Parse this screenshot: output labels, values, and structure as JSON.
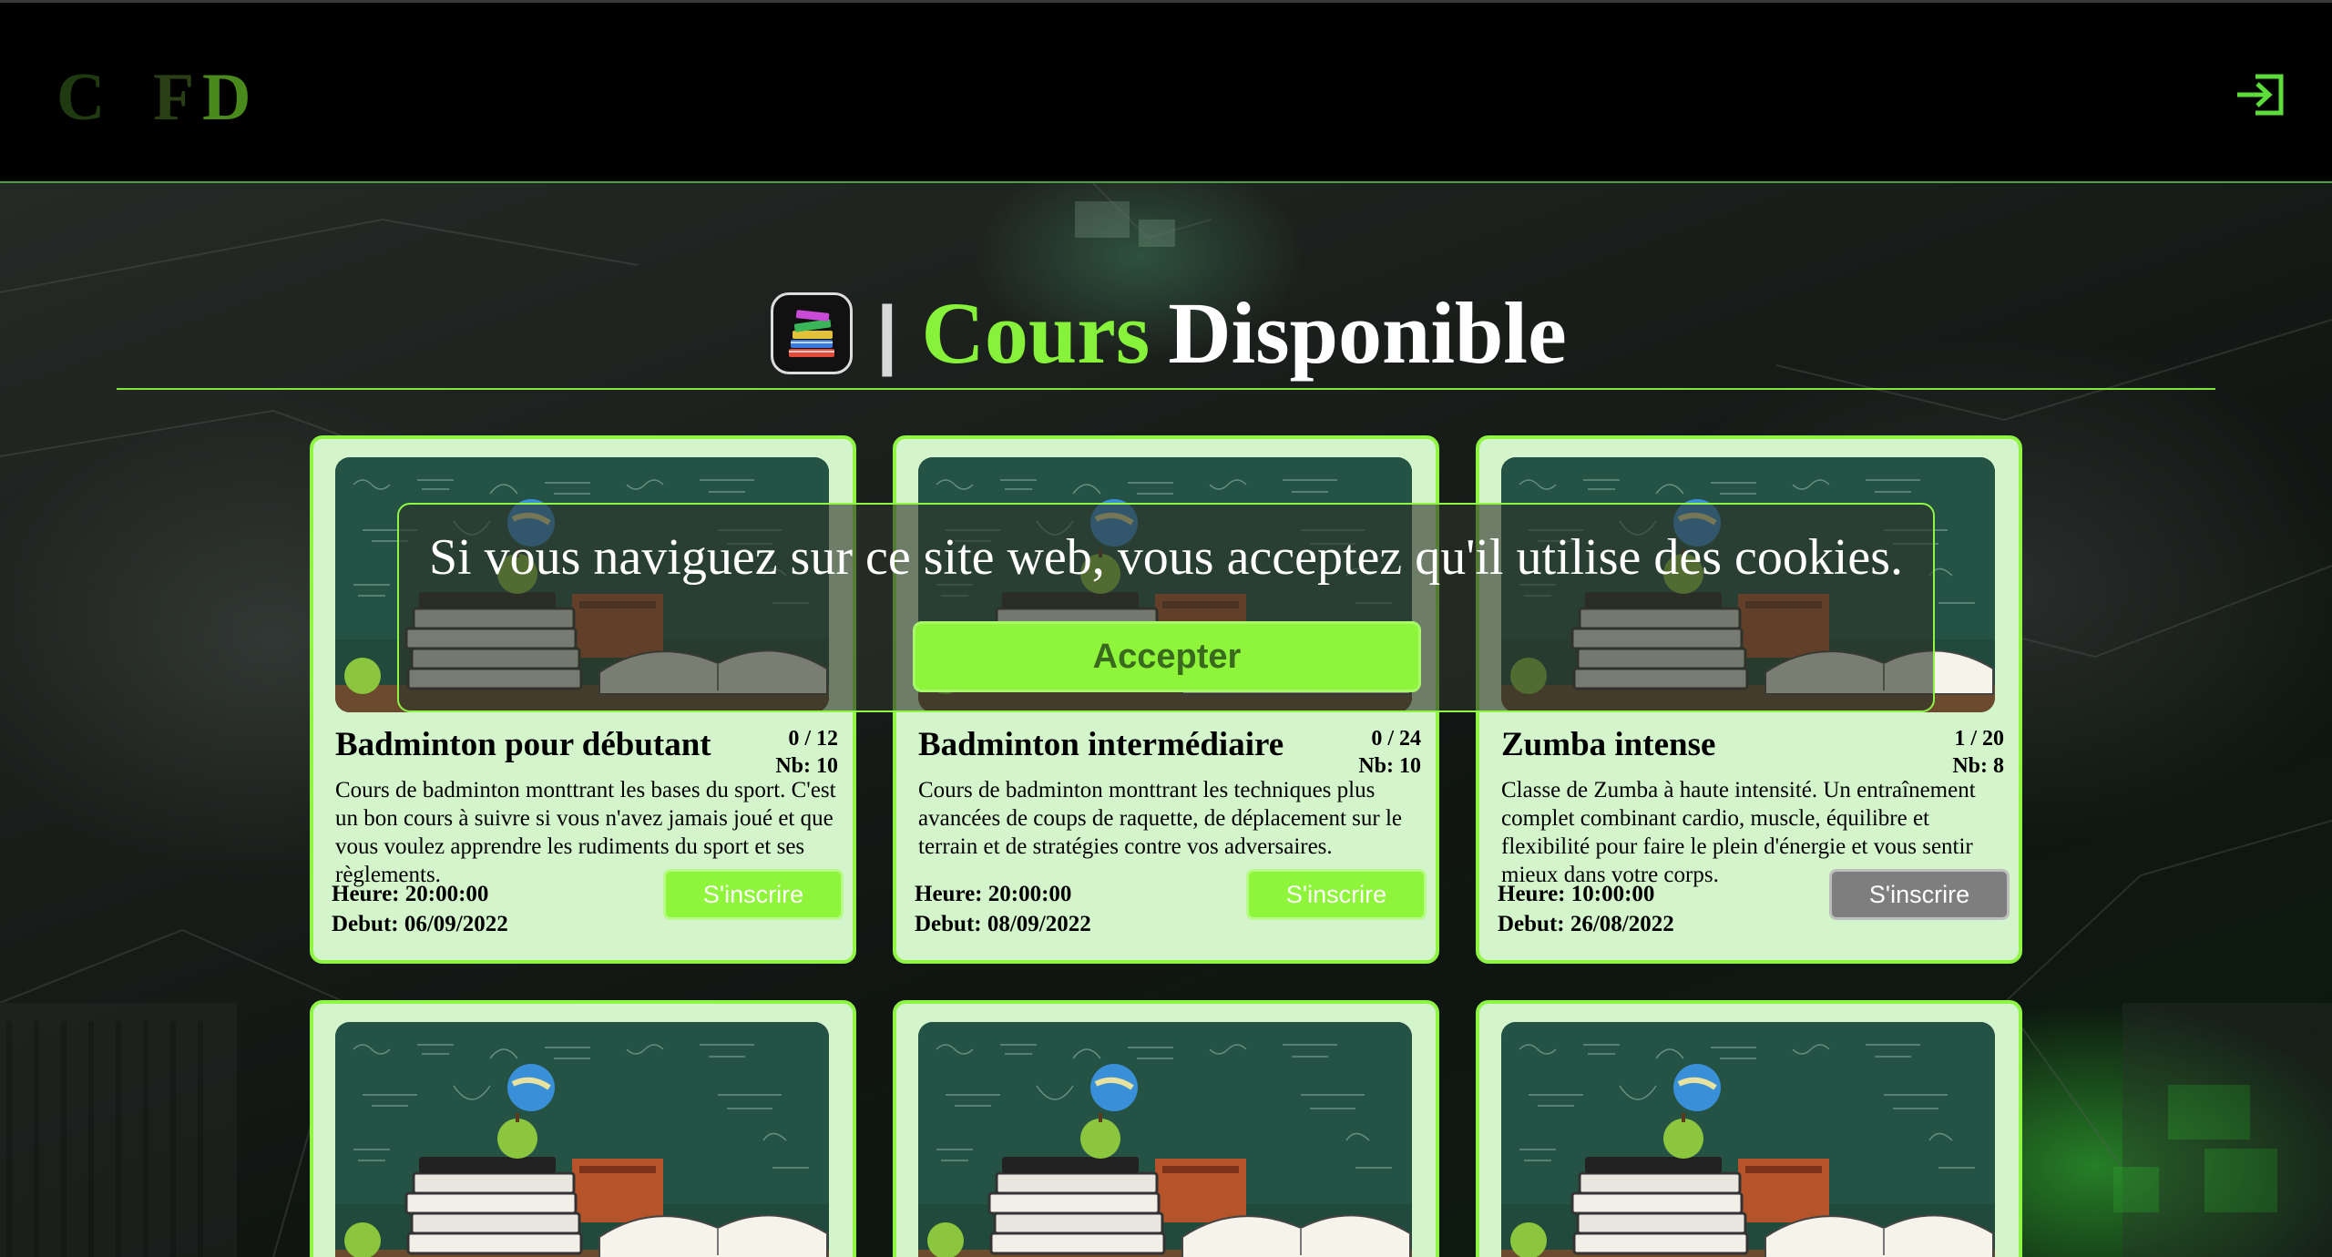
{
  "header": {
    "logo_letters": [
      "C",
      "F",
      "D"
    ],
    "login_icon": "sign-in-icon"
  },
  "page": {
    "title_icon": "books-icon",
    "title_separator": "|",
    "title_green": "Cours",
    "title_white": "Disponible"
  },
  "courses": [
    {
      "title": "Badminton pour débutant",
      "count": "0 / 12",
      "nb": "Nb: 10",
      "description": "Cours de badminton monttrant les bases du sport. C'est un bon cours à suivre si vous n'avez jamais joué et que vous voulez apprendre les rudiments du sport et ses règlements.",
      "heure": "Heure: 20:00:00",
      "debut": "Debut: 06/09/2022",
      "button_label": "S'inscrire",
      "button_enabled": true
    },
    {
      "title": "Badminton intermédiaire",
      "count": "0 / 24",
      "nb": "Nb: 10",
      "description": "Cours de badminton monttrant les techniques plus avancées de coups de raquette, de déplacement sur le terrain et de stratégies contre vos adversaires.",
      "heure": "Heure: 20:00:00",
      "debut": "Debut: 08/09/2022",
      "button_label": "S'inscrire",
      "button_enabled": true
    },
    {
      "title": "Zumba intense",
      "count": "1 / 20",
      "nb": "Nb: 8",
      "description": "Classe de Zumba à haute intensité. Un entraînement complet combinant cardio, muscle, équilibre et flexibilité pour faire le plein d'énergie et vous sentir mieux dans votre corps.",
      "heure": "Heure: 10:00:00",
      "debut": "Debut: 26/08/2022",
      "button_label": "S'inscrire",
      "button_enabled": false
    }
  ],
  "cookie_banner": {
    "message": "Si vous naviguez sur ce site web, vous acceptez qu'il utilise des cookies.",
    "accept_label": "Accepter"
  },
  "colors": {
    "accent_green": "#8ef53a",
    "card_bg": "#d4f5cc",
    "disabled_button": "#7e7e7e"
  }
}
